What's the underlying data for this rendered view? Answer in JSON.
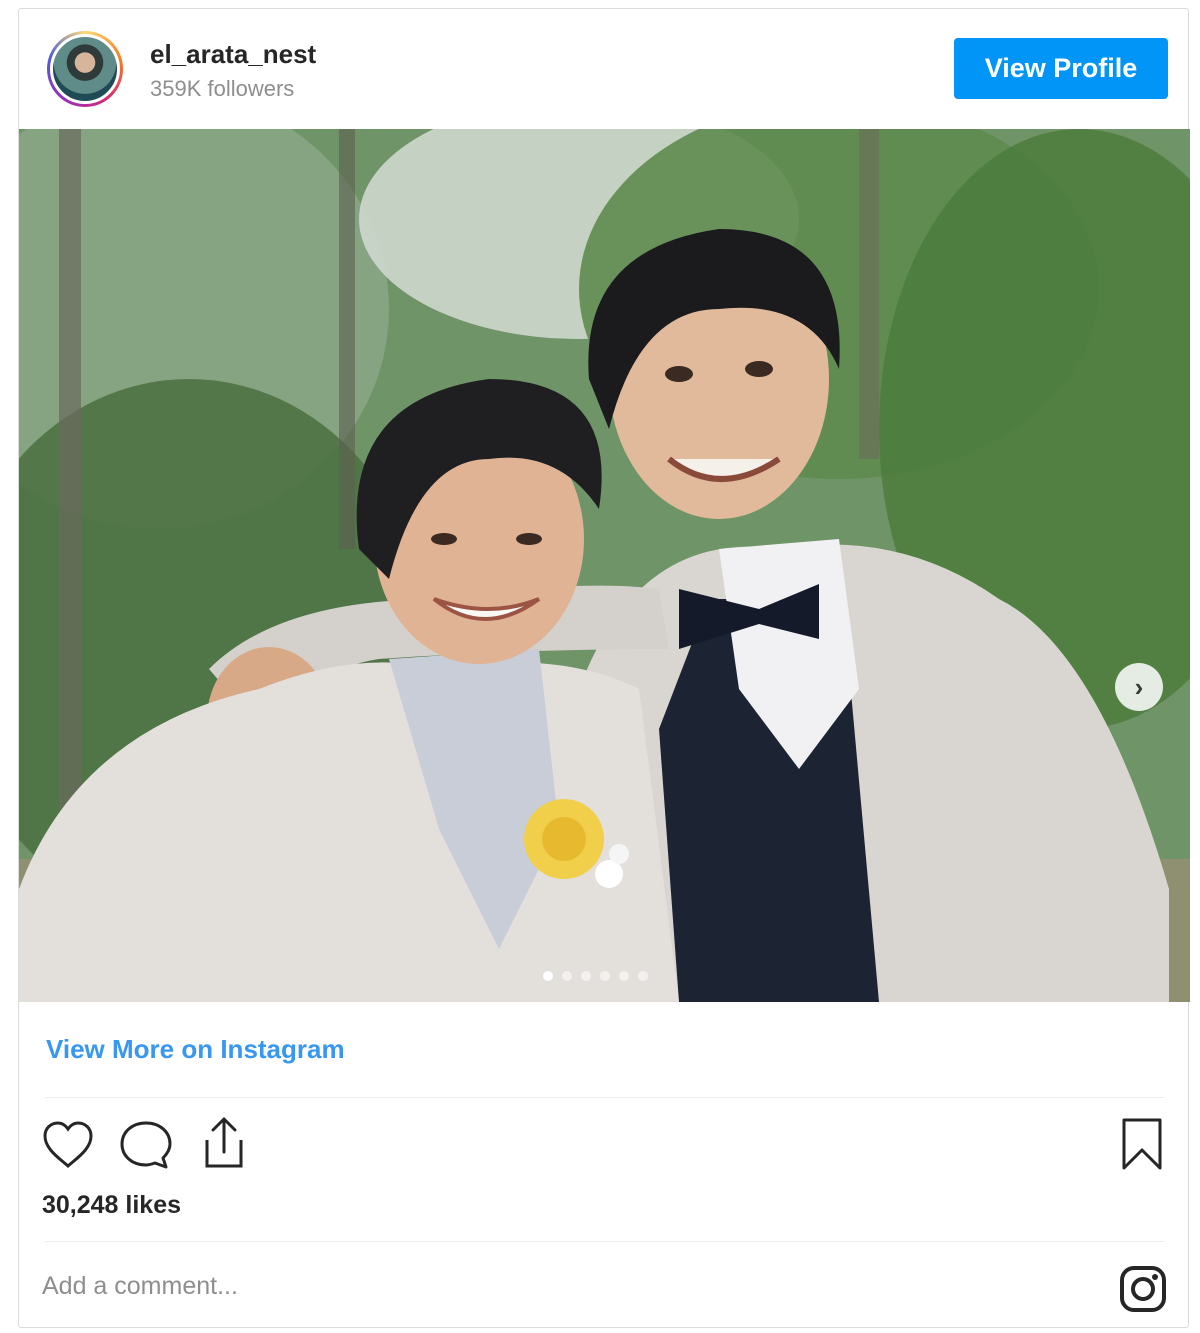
{
  "header": {
    "username": "el_arata_nest",
    "followers": "359K followers",
    "view_profile_label": "View Profile"
  },
  "post": {
    "carousel_total": 6,
    "carousel_active": 1
  },
  "footer": {
    "view_more_label": "View More on Instagram",
    "likes": "30,248 likes",
    "comment_placeholder": "Add a comment..."
  },
  "icons": {
    "avatar": "profile-avatar",
    "next": "chevron-right-icon",
    "like": "heart-icon",
    "comment": "comment-icon",
    "share": "share-icon",
    "save": "bookmark-icon",
    "brand": "instagram-icon"
  },
  "colors": {
    "accent": "#0095f6",
    "link": "#3897f0",
    "muted": "#8e8e8e"
  }
}
